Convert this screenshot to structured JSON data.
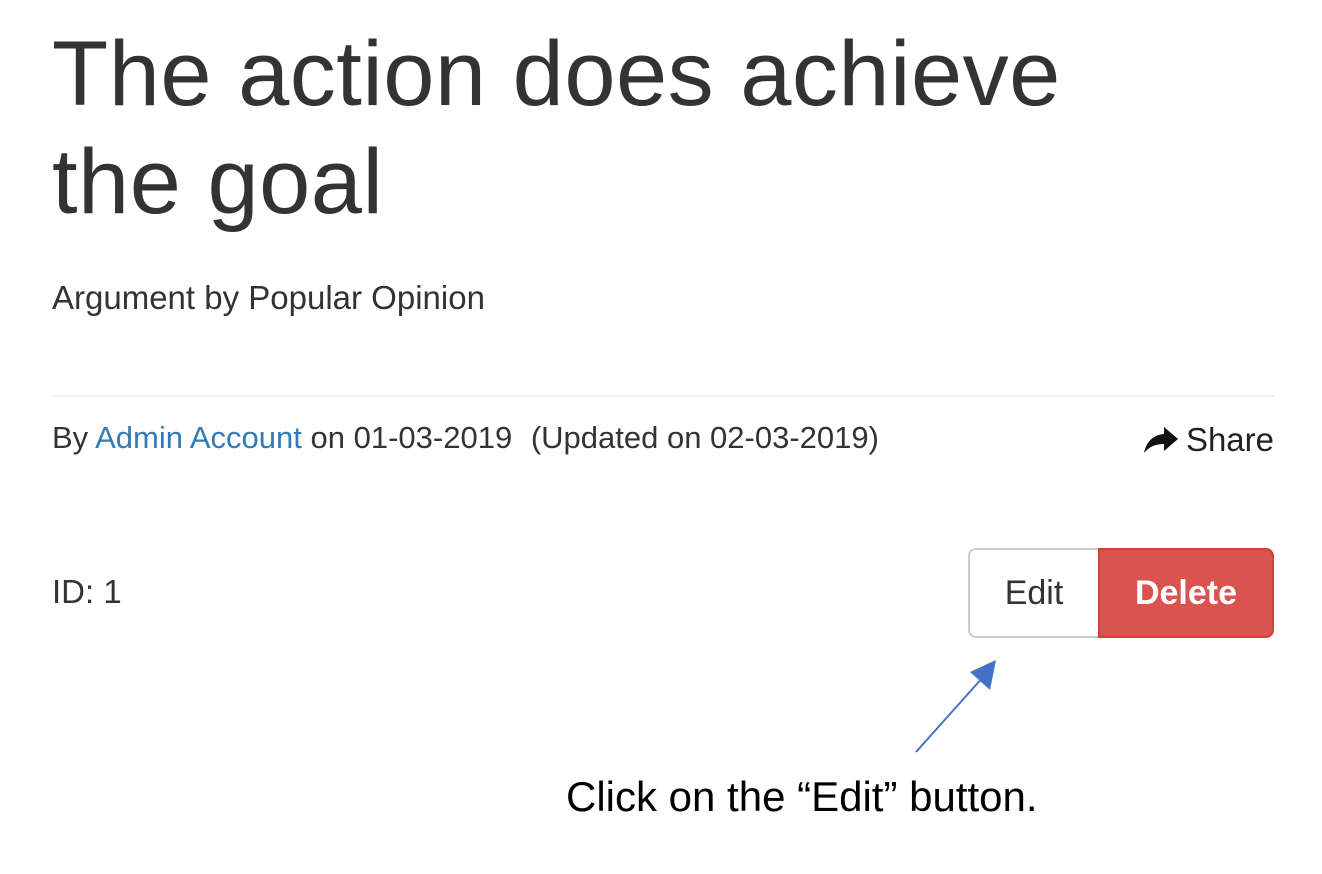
{
  "post": {
    "title": "The action does achieve the goal",
    "subtitle": "Argument by Popular Opinion"
  },
  "meta": {
    "by_prefix": "By",
    "author": "Admin Account",
    "on_prefix": "on",
    "date": "01-03-2019",
    "updated": "(Updated on 02-03-2019)",
    "share_label": "Share",
    "share_icon": "share-arrow-icon"
  },
  "record": {
    "id_label": "ID: 1"
  },
  "actions": {
    "edit_label": "Edit",
    "delete_label": "Delete"
  },
  "annotation": {
    "instruction": "Click on the “Edit” button."
  },
  "colors": {
    "link": "#337ab7",
    "danger": "#d9534f",
    "annotation_arrow": "#4472c4"
  }
}
